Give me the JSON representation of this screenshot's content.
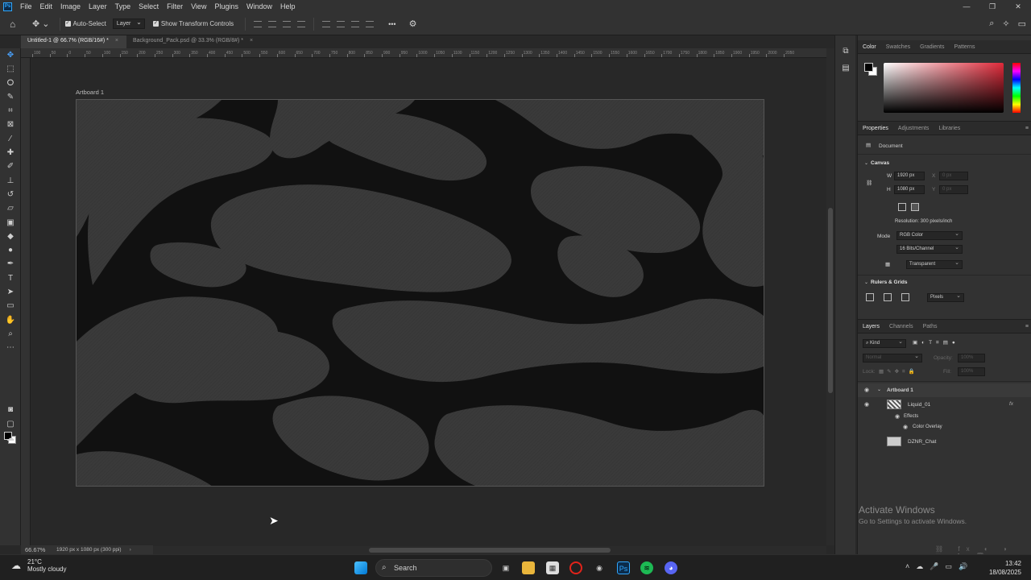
{
  "app": {
    "logo": "Ps",
    "menu": [
      "File",
      "Edit",
      "Image",
      "Layer",
      "Type",
      "Select",
      "Filter",
      "View",
      "Plugins",
      "Window",
      "Help"
    ],
    "window_controls": [
      "—",
      "❐",
      "✕"
    ]
  },
  "options_bar": {
    "auto_select_label": "Auto-Select",
    "auto_select_checked": true,
    "layer_select_value": "Layer",
    "show_transform_label": "Show Transform Controls",
    "show_transform_checked": true,
    "more_label": "•••"
  },
  "tabs": [
    {
      "label": "Untitled-1 @ 66.7% (RGB/16#) *",
      "active": true
    },
    {
      "label": "Background_Pack.psd @ 33.3% (RGB/8#) *",
      "active": false
    }
  ],
  "tools": [
    "move-icon",
    "marquee-icon",
    "lasso-icon",
    "quick-select-icon",
    "crop-icon",
    "frame-icon",
    "eyedropper-icon",
    "healing-icon",
    "brush-icon",
    "stamp-icon",
    "history-brush-icon",
    "eraser-icon",
    "gradient-icon",
    "blur-icon",
    "dodge-icon",
    "pen-icon",
    "type-icon",
    "path-select-icon",
    "shape-icon",
    "hand-icon",
    "zoom-icon",
    "more-tools-icon"
  ],
  "ruler": {
    "h_ticks": [
      "100",
      "50",
      "0",
      "50",
      "100",
      "150",
      "200",
      "250",
      "300",
      "350",
      "400",
      "450",
      "500",
      "550",
      "600",
      "650",
      "700",
      "750",
      "800",
      "850",
      "900",
      "950",
      "1000",
      "1050",
      "1100",
      "1150",
      "1200",
      "1250",
      "1300",
      "1350",
      "1400",
      "1450",
      "1500",
      "1550",
      "1600",
      "1650",
      "1700",
      "1750",
      "1800",
      "1850",
      "1900",
      "1950",
      "2000",
      "2050"
    ]
  },
  "canvas": {
    "artboard_label": "Artboard 1",
    "base_color": "#111111",
    "swirl_color": "#3a3a3a"
  },
  "status": {
    "zoom": "66.67%",
    "doc_info": "1920 px x 1080 px (300 ppi)"
  },
  "color_panel": {
    "tabs": [
      "Color",
      "Swatches",
      "Gradients",
      "Patterns"
    ],
    "active_tab": "Color",
    "fg": "#000000",
    "bg": "#ffffff"
  },
  "properties_panel": {
    "tabs": [
      "Properties",
      "Adjustments",
      "Libraries"
    ],
    "active_tab": "Properties",
    "doc_label": "Document",
    "canvas_title": "Canvas",
    "w_label": "W",
    "w_value": "1920 px",
    "h_label": "H",
    "h_value": "1080 px",
    "x_label": "X",
    "x_value": "0 px",
    "y_label": "Y",
    "y_value": "0 px",
    "resolution": "Resolution: 300 pixels/inch",
    "mode_label": "Mode",
    "mode_value": "RGB Color",
    "bits_value": "16 Bits/Channel",
    "fill_value": "Transparent",
    "rulers_title": "Rulers & Grids",
    "units_value": "Pixels"
  },
  "layers_panel": {
    "tabs": [
      "Layers",
      "Channels",
      "Paths"
    ],
    "active_tab": "Layers",
    "kind_filter": "Kind",
    "blend_mode": "Normal",
    "opacity_label": "Opacity:",
    "opacity_value": "100%",
    "lock_label": "Lock:",
    "fill_label": "Fill:",
    "fill_value": "100%",
    "layers": [
      {
        "name": "Artboard 1",
        "type": "artboard",
        "visible": true
      },
      {
        "name": "Liquid_01",
        "type": "layer",
        "visible": true,
        "fx": "fx"
      },
      {
        "name": "Effects",
        "type": "effects",
        "visible": true
      },
      {
        "name": "Color Overlay",
        "type": "effect",
        "visible": true
      },
      {
        "name": "DZNR_Chat",
        "type": "layer",
        "visible": false
      }
    ]
  },
  "watermark": {
    "line1": "Activate Windows",
    "line2": "Go to Settings to activate Windows."
  },
  "taskbar": {
    "weather_temp": "21°C",
    "weather_desc": "Mostly cloudy",
    "search_label": "Search",
    "time": "13:42",
    "date": "18/08/2025"
  }
}
